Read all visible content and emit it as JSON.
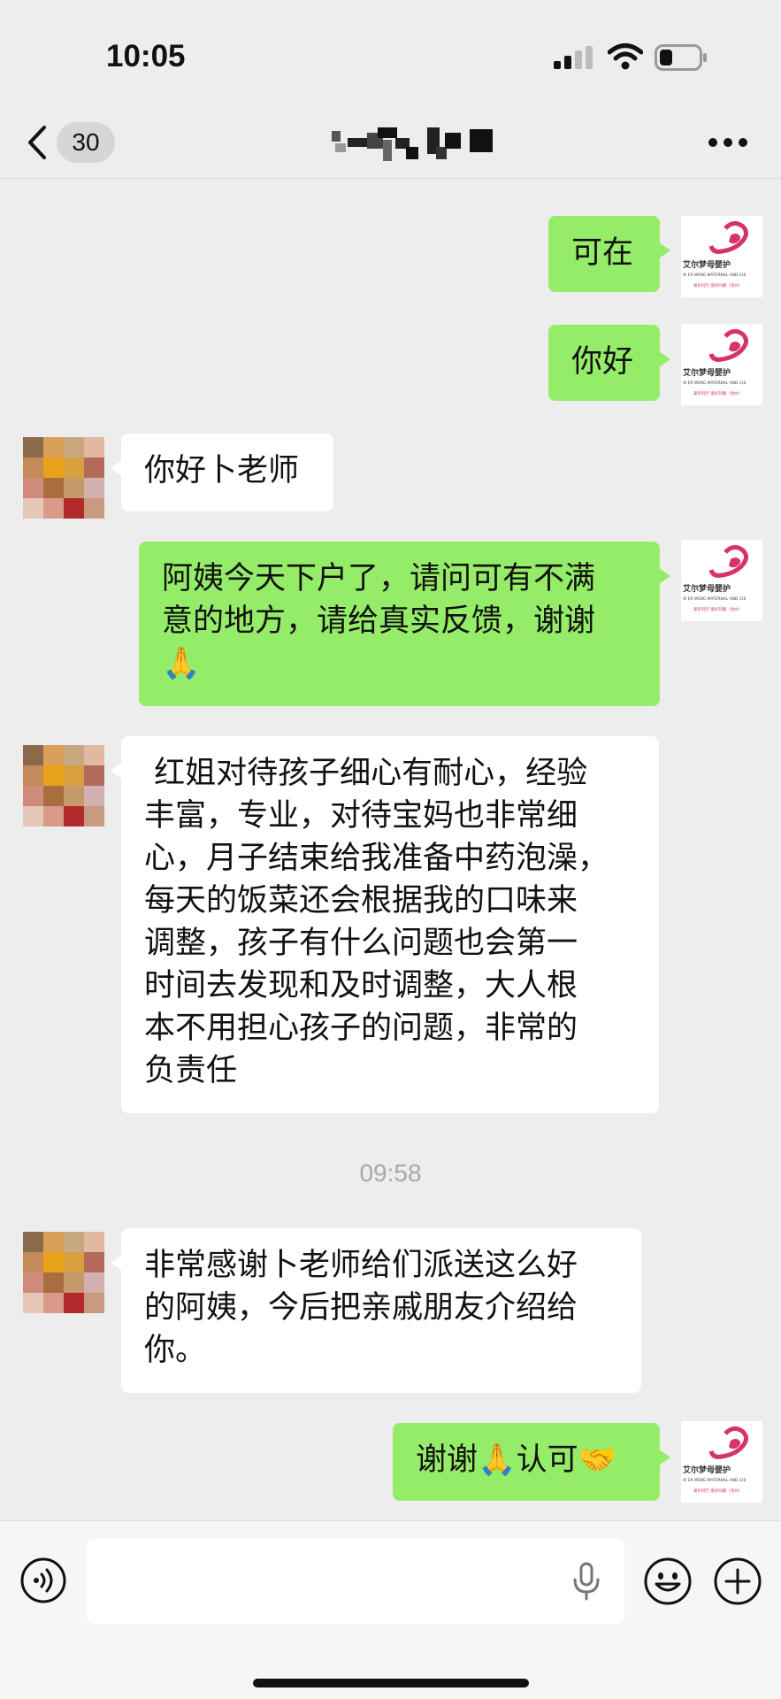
{
  "status_bar": {
    "time": "10:05"
  },
  "nav": {
    "unread_count": "30"
  },
  "messages": {
    "m1": {
      "text": "可在"
    },
    "m2": {
      "text": "你好"
    },
    "m3": {
      "text": "你好卜老师"
    },
    "m4": {
      "text": "阿姨今天下户了，请问可有不满\n意的地方，请给真实反馈，谢谢\n🙏"
    },
    "m5": {
      "text": " 红姐对待孩子细心有耐心，经验\n丰富，专业，对待宝妈也非常细\n心，月子结束给我准备中药泡澡，\n每天的饭菜还会根据我的口味来\n调整，孩子有什么问题也会第一\n时间去发现和及时调整，大人根\n本不用担心孩子的问题，非常的\n负责任"
    },
    "timestamp": "09:58",
    "m6": {
      "text": "非常感谢卜老师给们派送这么好\n的阿姨，今后把亲戚朋友介绍给\n你。"
    },
    "m7": {
      "text": "谢谢🙏认可🤝"
    }
  },
  "my_avatar": {
    "logo_text_cn": "艾尔梦母婴护",
    "logo_text_en": "AI ER MENG MATERNAL AND CHI",
    "logo_small": "爱护同行  爱好同路（池州）"
  },
  "colors": {
    "outgoing_bubble": "#95ec69",
    "incoming_bubble": "#ffffff",
    "background": "#ededed",
    "brand_pink": "#d6336c"
  },
  "icons": {
    "back": "chevron-left-icon",
    "more": "more-dots-icon",
    "voice": "voice-icon",
    "mic": "mic-icon",
    "emoji": "emoji-icon",
    "plus": "plus-icon"
  }
}
